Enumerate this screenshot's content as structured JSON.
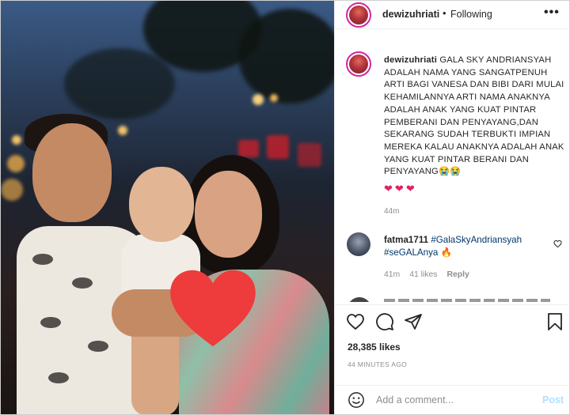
{
  "header": {
    "username": "dewizuhriati",
    "separator": "•",
    "follow_status": "Following",
    "more_icon": "more-horizontal-icon",
    "more_label": "•••"
  },
  "caption": {
    "username": "dewizuhriati",
    "text": "GALA SKY ANDRIANSYAH ADALAH NAMA YANG SANGATPENUH ARTI BAGI VANESA DAN BIBI DARI MULAI KEHAMILANNYA ARTI NAMA ANAKNYA ADALAH ANAK YANG KUAT PINTAR PEMBERANI DAN PENYAYANG,DAN SEKARANG SUDAH TERBUKTI IMPIAN MEREKA KALAU ANAKNYA ADALAH ANAK YANG KUAT PINTAR BERANI DAN PENYAYANG",
    "emojis": "😭😭",
    "hearts": [
      "❤",
      "❤",
      "❤"
    ],
    "time": "44m"
  },
  "comment": {
    "username": "fatma1711",
    "tag1": "#GalaSkyAndriansyah",
    "tag2": "#seGALAnya",
    "fire": "🔥",
    "time": "41m",
    "likes": "41 likes",
    "reply": "Reply",
    "like_icon": "heart-outline-icon"
  },
  "actions": {
    "icons": [
      "heart-outline-icon",
      "comment-icon",
      "share-icon",
      "bookmark-icon"
    ]
  },
  "likes_count": "28,385 likes",
  "post_time": "44 MINUTES AGO",
  "add_comment": {
    "placeholder": "Add a comment...",
    "post_label": "Post"
  },
  "colors": {
    "link": "#00376b",
    "secondary_text": "#8e8e8e",
    "post_disabled": "#b2dffc",
    "heart": "#e0245e",
    "overlay_heart": "#ee3b3b"
  }
}
